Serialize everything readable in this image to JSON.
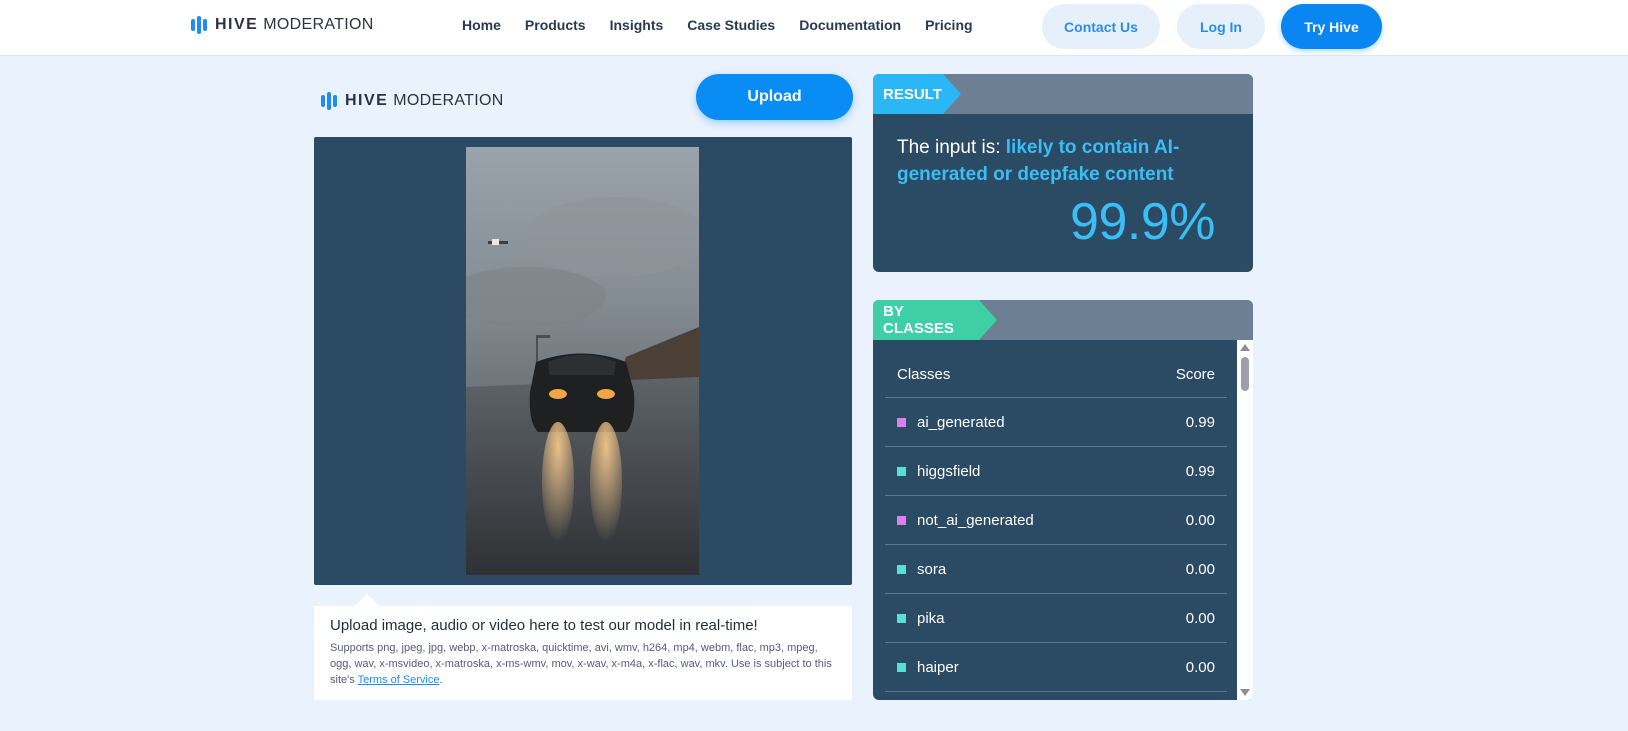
{
  "brand": {
    "hive": "HIVE",
    "moderation": "MODERATION"
  },
  "nav": {
    "links": [
      "Home",
      "Products",
      "Insights",
      "Case Studies",
      "Documentation",
      "Pricing"
    ],
    "contact": "Contact Us",
    "login": "Log In",
    "try": "Try Hive"
  },
  "panel": {
    "upload_label": "Upload",
    "info_title": "Upload image, audio or video here to test our model in real-time!",
    "info_sub": "Supports png, jpeg, jpg, webp, x-matroska, quicktime, avi, wmv, h264, mp4, webm, flac, mp3, mpeg, ogg, wav, x-msvideo, x-matroska, x-ms-wmv, mov, x-wav, x-m4a, x-flac, wav, mkv. Use is subject to this site's ",
    "tos": "Terms of Service",
    "tos_end": "."
  },
  "result": {
    "tag": "RESULT",
    "prefix": "The input is: ",
    "verdict": "likely to contain AI-generated or deepfake content",
    "percent": "99.9%"
  },
  "classes": {
    "tag": "BY CLASSES",
    "col_class": "Classes",
    "col_score": "Score",
    "rows": [
      {
        "name": "ai_generated",
        "score": "0.99",
        "color": "#e07ef0"
      },
      {
        "name": "higgsfield",
        "score": "0.99",
        "color": "#57e0d8"
      },
      {
        "name": "not_ai_generated",
        "score": "0.00",
        "color": "#e07ef0"
      },
      {
        "name": "sora",
        "score": "0.00",
        "color": "#57e0d8"
      },
      {
        "name": "pika",
        "score": "0.00",
        "color": "#57e0d8"
      },
      {
        "name": "haiper",
        "score": "0.00",
        "color": "#57e0d8"
      }
    ]
  },
  "colors": {
    "accent": "#0a86f2",
    "card": "#2b4a63",
    "result_tag": "#2bb6f5",
    "classes_tag": "#3ecfa6"
  }
}
